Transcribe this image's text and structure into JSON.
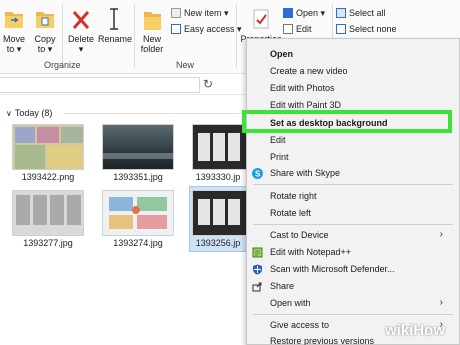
{
  "ribbon": {
    "move_to": "Move",
    "move_to_sub": "to ▾",
    "copy_to": "Copy",
    "copy_to_sub": "to ▾",
    "delete": "Delete",
    "delete_sub": "▾",
    "rename": "Rename",
    "new_folder": "New",
    "new_folder_sub": "folder",
    "new_item": "New item ▾",
    "easy_access": "Easy access ▾",
    "properties": "Properties",
    "open": "Open ▾",
    "edit": "Edit",
    "select_all": "Select all",
    "select_none": "Select none",
    "group_organize": "Organize",
    "group_new": "New"
  },
  "content": {
    "group_title": "Today (8)",
    "files": [
      {
        "name": "1393422.png"
      },
      {
        "name": "1393351.jpg"
      },
      {
        "name": "1393330.jp"
      },
      {
        "name": "1393277.jpg"
      },
      {
        "name": "1393274.jpg"
      },
      {
        "name": "1393256.jp"
      }
    ]
  },
  "context_menu": {
    "items": [
      {
        "label": "Open"
      },
      {
        "label": "Create a new video"
      },
      {
        "label": "Edit with Photos"
      },
      {
        "label": "Edit with Paint 3D"
      },
      {
        "label": "Set as desktop background"
      },
      {
        "label": "Edit"
      },
      {
        "label": "Print"
      },
      {
        "label": "Share with Skype"
      },
      {
        "label": "Rotate right"
      },
      {
        "label": "Rotate left"
      },
      {
        "label": "Cast to Device"
      },
      {
        "label": "Edit with Notepad++"
      },
      {
        "label": "Scan with Microsoft Defender..."
      },
      {
        "label": "Share"
      },
      {
        "label": "Open with"
      },
      {
        "label": "Give access to"
      },
      {
        "label": "Restore previous versions"
      }
    ]
  },
  "watermark": "wikiHow",
  "colors": {
    "highlight": "#3ee33a",
    "selection": "#cfe3f7",
    "delete_red": "#d3322b"
  }
}
